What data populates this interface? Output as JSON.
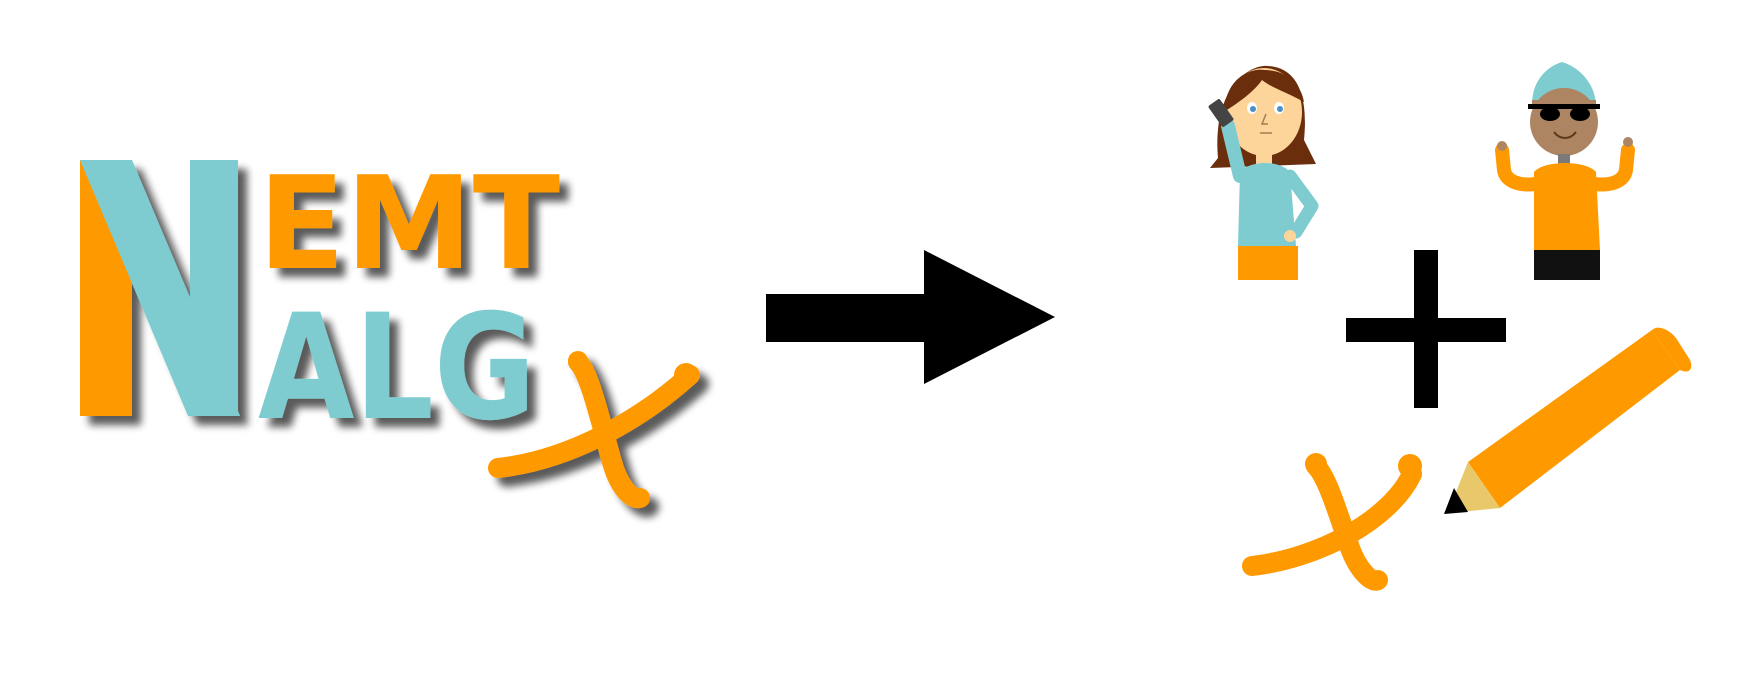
{
  "logo": {
    "letter_n": "N",
    "word_top": "EMT",
    "word_bottom": "ALG",
    "icon": "script-x-icon"
  },
  "colors": {
    "orange": "#FF9900",
    "teal": "#7ECCCF",
    "black": "#000000",
    "white": "#FFFFFF",
    "hair": "#6B2E0C",
    "skin_light": "#FDD59B",
    "skin_dark": "#AD8562",
    "pencil_tip": "#E8C86A"
  },
  "icons": {
    "arrow": "right-arrow-icon",
    "woman": "woman-phone-icon",
    "man": "man-cap-sunglasses-icon",
    "plus": "plus-icon",
    "x": "script-x-icon",
    "pencil": "pencil-icon"
  }
}
